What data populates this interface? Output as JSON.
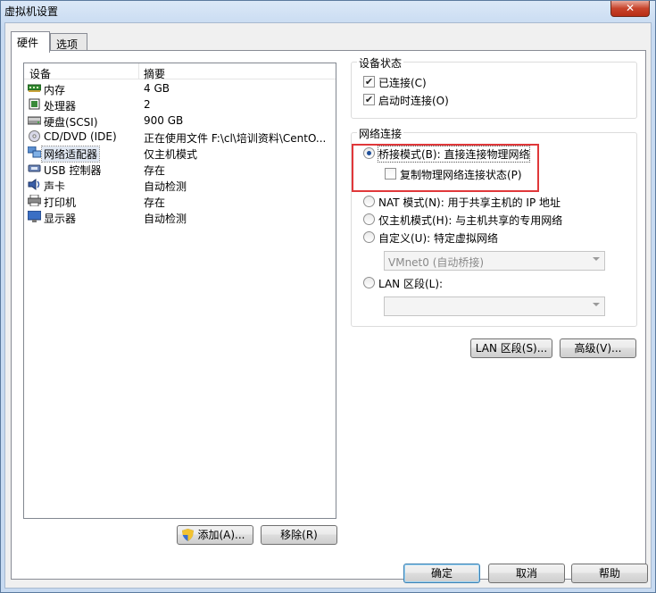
{
  "window": {
    "title": "虚拟机设置",
    "close_label": "✕"
  },
  "tabs": [
    {
      "label": "硬件"
    },
    {
      "label": "选项"
    }
  ],
  "device_list": {
    "col_device": "设备",
    "col_summary": "摘要",
    "rows": [
      {
        "name": "内存",
        "summary": "4 GB",
        "icon": "memory-icon"
      },
      {
        "name": "处理器",
        "summary": "2",
        "icon": "processor-icon"
      },
      {
        "name": "硬盘(SCSI)",
        "summary": "900 GB",
        "icon": "harddisk-icon"
      },
      {
        "name": "CD/DVD (IDE)",
        "summary": "正在使用文件 F:\\cl\\培训资料\\CentO...",
        "icon": "cd-dvd-icon"
      },
      {
        "name": "网络适配器",
        "summary": "仅主机模式",
        "icon": "network-adapter-icon"
      },
      {
        "name": "USB 控制器",
        "summary": "存在",
        "icon": "usb-icon"
      },
      {
        "name": "声卡",
        "summary": "自动检测",
        "icon": "sound-card-icon"
      },
      {
        "name": "打印机",
        "summary": "存在",
        "icon": "printer-icon"
      },
      {
        "name": "显示器",
        "summary": "自动检测",
        "icon": "display-icon"
      }
    ]
  },
  "device_buttons": {
    "add": "添加(A)...",
    "remove": "移除(R)"
  },
  "device_status": {
    "title": "设备状态",
    "connected": "已连接(C)",
    "connect_on_start": "启动时连接(O)"
  },
  "network": {
    "title": "网络连接",
    "bridged": "桥接模式(B): 直接连接物理网络",
    "replicate": "复制物理网络连接状态(P)",
    "nat": "NAT 模式(N): 用于共享主机的 IP 地址",
    "host_only": "仅主机模式(H): 与主机共享的专用网络",
    "custom": "自定义(U): 特定虚拟网络",
    "custom_combo": "VMnet0 (自动桥接)",
    "lan_segment": "LAN 区段(L):",
    "lan_combo": ""
  },
  "network_buttons": {
    "lan": "LAN 区段(S)...",
    "advanced": "高级(V)..."
  },
  "footer": {
    "ok": "确定",
    "cancel": "取消",
    "help": "帮助"
  }
}
